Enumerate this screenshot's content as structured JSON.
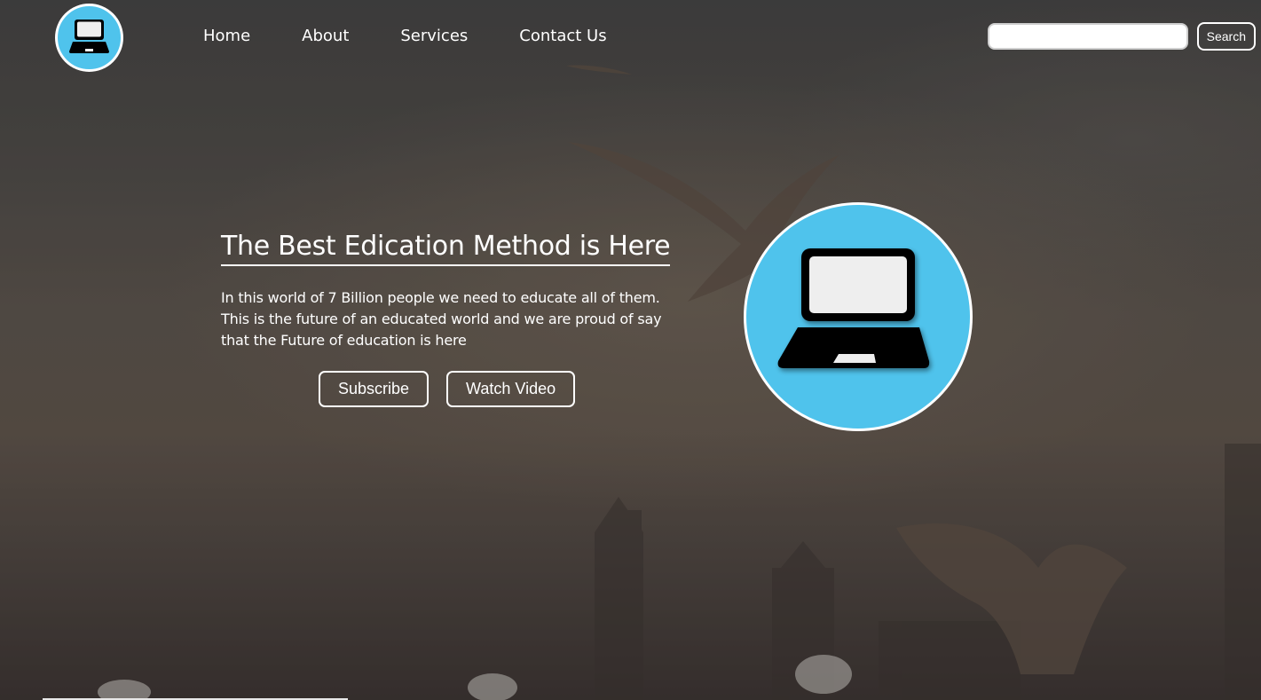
{
  "nav": {
    "logo_icon": "laptop-icon",
    "links": [
      {
        "label": "Home"
      },
      {
        "label": "About"
      },
      {
        "label": "Services"
      },
      {
        "label": "Contact Us"
      }
    ],
    "search": {
      "value": "",
      "placeholder": "",
      "button_label": "Search"
    }
  },
  "hero": {
    "title": "The Best Edication Method is Here",
    "description": "In this world of 7 Billion people we need to educate all of them. This is the future of an educated world and we are proud of say that the Future of education is here",
    "buttons": {
      "subscribe": "Subscribe",
      "watch_video": "Watch Video"
    },
    "image_icon": "laptop-icon"
  },
  "colors": {
    "accent": "#4fc3ec",
    "text": "#ffffff",
    "laptop": "#000000",
    "screen": "#eeeeee"
  }
}
